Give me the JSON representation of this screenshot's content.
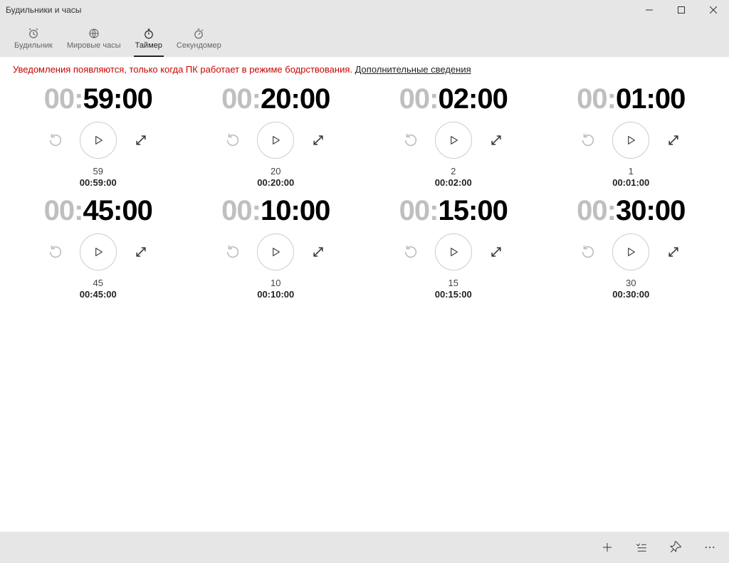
{
  "window": {
    "title": "Будильники и часы"
  },
  "tabs": {
    "alarm": "Будильник",
    "world": "Мировые часы",
    "timer": "Таймер",
    "stopwatch": "Секундомер"
  },
  "banner": {
    "text": "Уведомления появляются, только когда ПК работает в режиме бодрствования. ",
    "link": "Дополнительные сведения"
  },
  "timers": [
    {
      "hours": "00",
      "minutes": "59",
      "seconds": "00",
      "label": "59",
      "duration": "00:59:00"
    },
    {
      "hours": "00",
      "minutes": "20",
      "seconds": "00",
      "label": "20",
      "duration": "00:20:00"
    },
    {
      "hours": "00",
      "minutes": "02",
      "seconds": "00",
      "label": "2",
      "duration": "00:02:00"
    },
    {
      "hours": "00",
      "minutes": "01",
      "seconds": "00",
      "label": "1",
      "duration": "00:01:00"
    },
    {
      "hours": "00",
      "minutes": "45",
      "seconds": "00",
      "label": "45",
      "duration": "00:45:00"
    },
    {
      "hours": "00",
      "minutes": "10",
      "seconds": "00",
      "label": "10",
      "duration": "00:10:00"
    },
    {
      "hours": "00",
      "minutes": "15",
      "seconds": "00",
      "label": "15",
      "duration": "00:15:00"
    },
    {
      "hours": "00",
      "minutes": "30",
      "seconds": "00",
      "label": "30",
      "duration": "00:30:00"
    }
  ]
}
